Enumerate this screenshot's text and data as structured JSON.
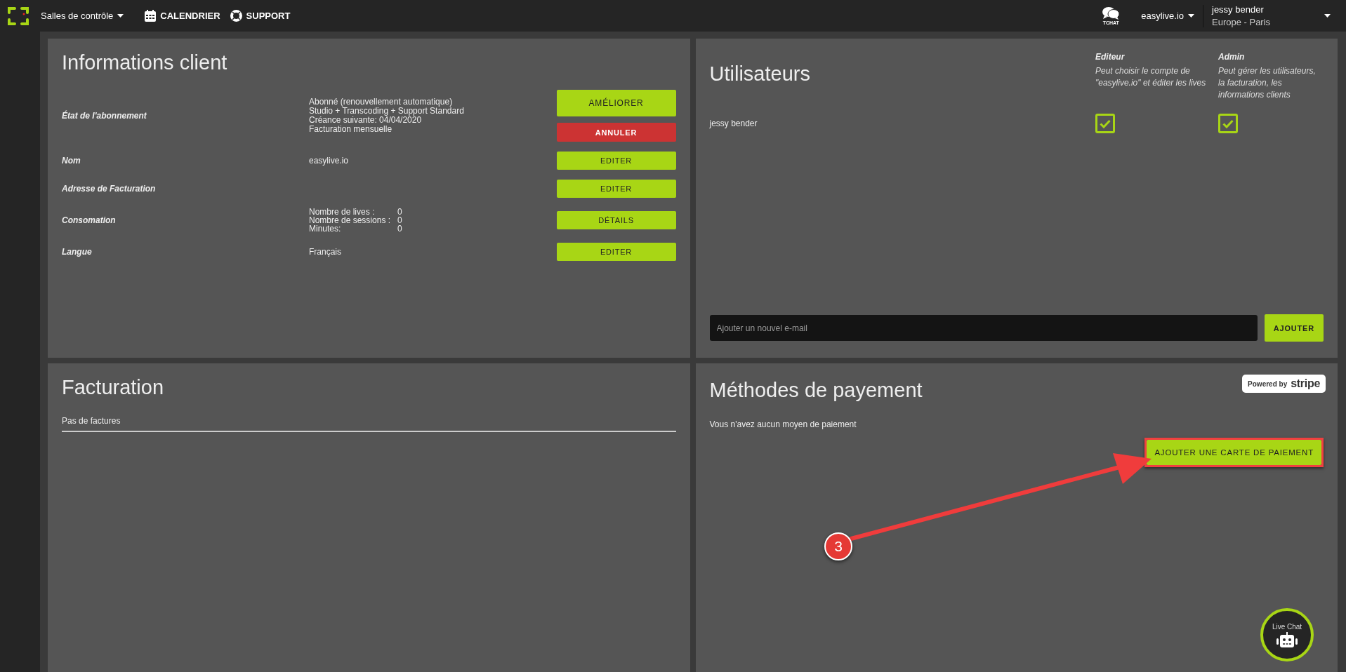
{
  "topbar": {
    "menu": "Salles de contrôle",
    "links": [
      {
        "label": "CALENDRIER"
      },
      {
        "label": "SUPPORT"
      }
    ],
    "chat_label": "TCHAT",
    "account": "easylive.io",
    "user": {
      "name": "jessy bender",
      "timezone": "Europe - Paris"
    }
  },
  "client_info": {
    "title": "Informations client",
    "rows": [
      {
        "label": "État de l'abonnement",
        "lines": [
          "Abonné (renouvellement automatique)",
          "Studio + Transcoding + Support Standard",
          "Créance suivante: 04/04/2020",
          "Facturation mensuelle"
        ],
        "buttons": [
          {
            "label": "AMÉLIORER",
            "kind": "large"
          },
          {
            "label": "ANNULER",
            "kind": "danger"
          }
        ]
      },
      {
        "label": "Nom",
        "lines": [
          "easylive.io"
        ],
        "buttons": [
          {
            "label": "EDITER",
            "kind": "small"
          }
        ]
      },
      {
        "label": "Adresse de Facturation",
        "lines": [],
        "buttons": [
          {
            "label": "EDITER",
            "kind": "small"
          }
        ]
      },
      {
        "label": "Consomation",
        "stats": [
          {
            "name": "Nombre de lives :",
            "value": "0"
          },
          {
            "name": "Nombre de sessions :",
            "value": "0"
          },
          {
            "name": "Minutes:",
            "value": "0"
          }
        ],
        "buttons": [
          {
            "label": "DÉTAILS",
            "kind": "small"
          }
        ]
      },
      {
        "label": "Langue",
        "lines": [
          "Français"
        ],
        "buttons": [
          {
            "label": "EDITER",
            "kind": "small"
          }
        ]
      }
    ]
  },
  "users": {
    "title": "Utilisateurs",
    "roles": [
      {
        "name": "Editeur",
        "description": "Peut choisir le compte de \"easylive.io\" et éditer les lives"
      },
      {
        "name": "Admin",
        "description": "Peut gérer les utilisateurs, la facturation, les informations clients"
      }
    ],
    "rows": [
      {
        "name": "jessy bender",
        "permissions": [
          {
            "checked": true
          },
          {
            "checked": true
          }
        ]
      }
    ],
    "email_field": {
      "placeholder": "Ajouter un nouvel e-mail"
    },
    "add_button": "AJOUTER"
  },
  "billing": {
    "title": "Facturation",
    "empty_text": "Pas de factures"
  },
  "payment": {
    "title": "Méthodes de payement",
    "badge": {
      "prefix": "Powered by",
      "brand": "stripe"
    },
    "empty_text": "Vous n'avez aucun moyen de paiement",
    "add_button": "AJOUTER UNE CARTE DE PAIEMENT",
    "highlighted": true
  },
  "annotation": {
    "step": "3"
  },
  "live_chat": {
    "label": "Live Chat"
  }
}
